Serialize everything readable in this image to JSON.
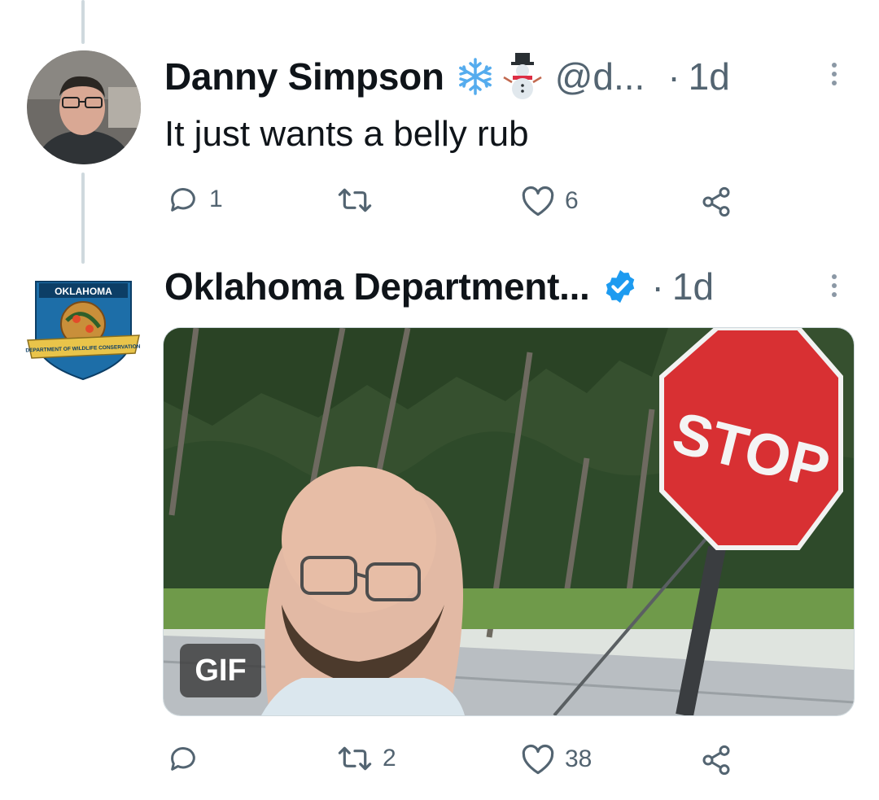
{
  "tweet1": {
    "author_name": "Danny Simpson",
    "handle": "@d...",
    "separator": "·",
    "time": "1d",
    "text": "It just wants a belly rub",
    "emoji": [
      "snowflake-icon",
      "snowman-icon"
    ],
    "actions": {
      "reply_count": "1",
      "retweet_count": "",
      "like_count": "6"
    }
  },
  "tweet2": {
    "author_name": "Oklahoma Department...",
    "verified": true,
    "separator": "·",
    "time": "1d",
    "avatar_logo": {
      "top_text": "OKLAHOMA",
      "banner_text": "DEPARTMENT OF WILDLIFE CONSERVATION"
    },
    "media": {
      "type": "gif",
      "badge": "GIF",
      "sign_text": "STOP"
    },
    "actions": {
      "reply_count": "",
      "retweet_count": "2",
      "like_count": "38"
    }
  },
  "colors": {
    "text_primary": "#0f1419",
    "text_secondary": "#536471",
    "verified_blue": "#1d9bf0",
    "thread_line": "#cfd9de"
  }
}
